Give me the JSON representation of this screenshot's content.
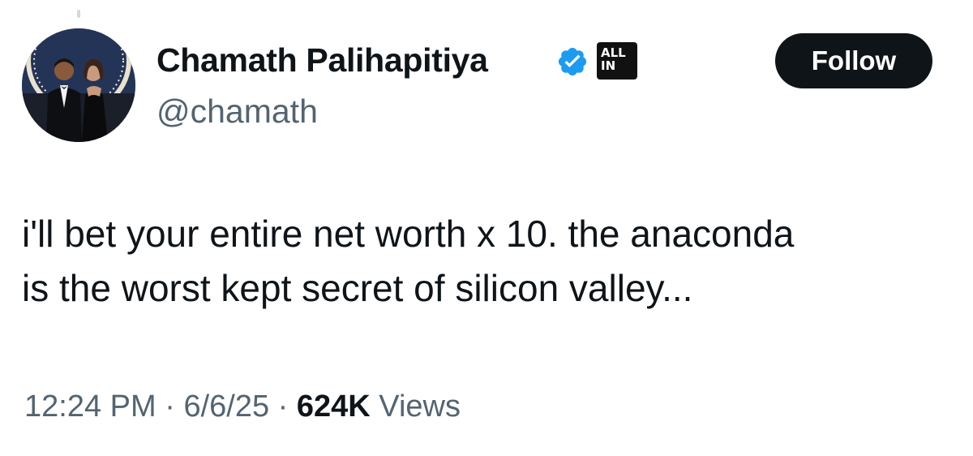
{
  "user": {
    "display_name": "Chamath Palihapitiya",
    "handle": "@chamath",
    "verified_icon": "verified-badge-icon",
    "affiliate_badge_line1": "ALL",
    "affiliate_badge_line2": "IN",
    "avatar_icon": "profile-photo"
  },
  "follow_button": {
    "label": "Follow"
  },
  "tweet": {
    "text_line1": "i'll bet your entire net worth x 10. the anaconda",
    "text_line2": "is the worst kept secret of silicon valley..."
  },
  "meta": {
    "time": "12:24 PM",
    "separator": "·",
    "date": "6/6/25",
    "views_count": "624K",
    "views_label": "Views"
  },
  "colors": {
    "text_primary": "#0f1419",
    "text_secondary": "#536471",
    "verified_blue": "#1d9bf0",
    "button_bg": "#0f1419",
    "background": "#ffffff"
  }
}
